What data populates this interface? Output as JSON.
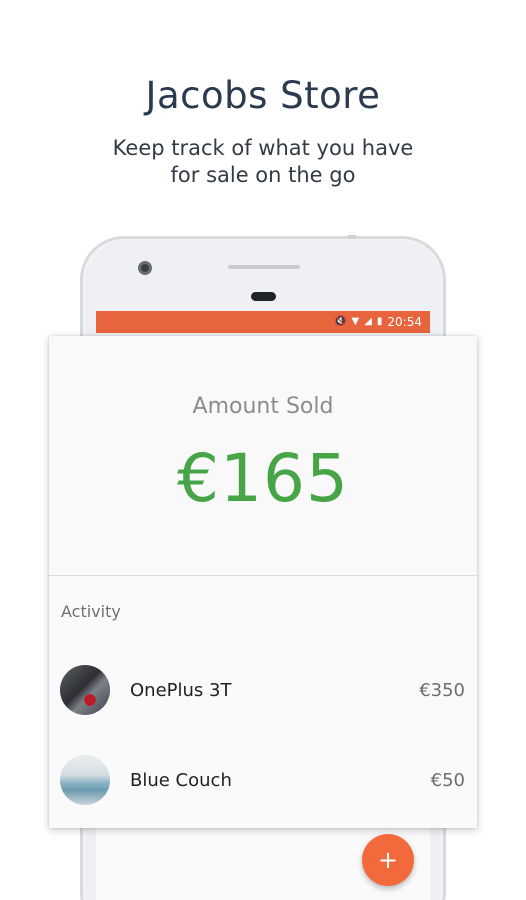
{
  "promo": {
    "title": "Jacobs Store",
    "subtitle_line1": "Keep track of what you have",
    "subtitle_line2": "for sale on the go"
  },
  "statusbar": {
    "time": "20:54",
    "icons": [
      "mute-icon",
      "wifi-icon",
      "signal-icon",
      "battery-icon"
    ]
  },
  "summary": {
    "label": "Amount Sold",
    "value": "€165",
    "value_color": "#47a547"
  },
  "activity": {
    "header": "Activity",
    "items": [
      {
        "title": "OnePlus 3T",
        "price": "€350",
        "thumbnail": "phone-photo"
      },
      {
        "title": "Blue Couch",
        "price": "€50",
        "thumbnail": "couch-photo"
      }
    ]
  },
  "fab": {
    "label": "+",
    "color": "#f26a3c"
  },
  "colors": {
    "accent": "#e8643c"
  }
}
